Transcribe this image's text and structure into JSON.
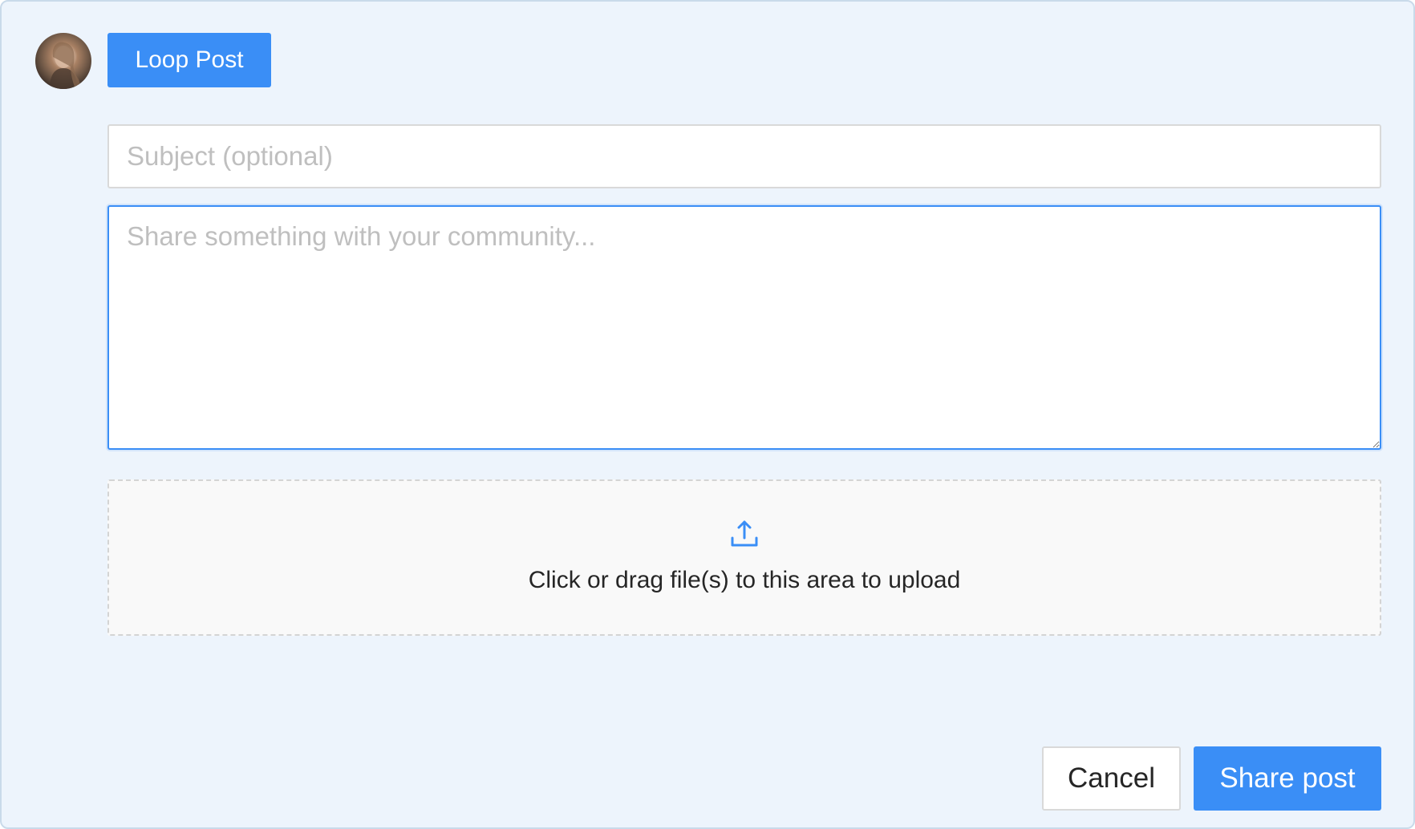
{
  "composer": {
    "post_type_label": "Loop Post",
    "subject_placeholder": "Subject (optional)",
    "subject_value": "",
    "body_placeholder": "Share something with your community...",
    "body_value": "",
    "upload_text": "Click or drag file(s) to this area to upload",
    "upload_icon": "upload-icon",
    "cancel_label": "Cancel",
    "share_label": "Share post"
  },
  "colors": {
    "accent": "#3a8ef6",
    "panel_background": "#edf4fc",
    "upload_background": "#f9f9f9"
  }
}
